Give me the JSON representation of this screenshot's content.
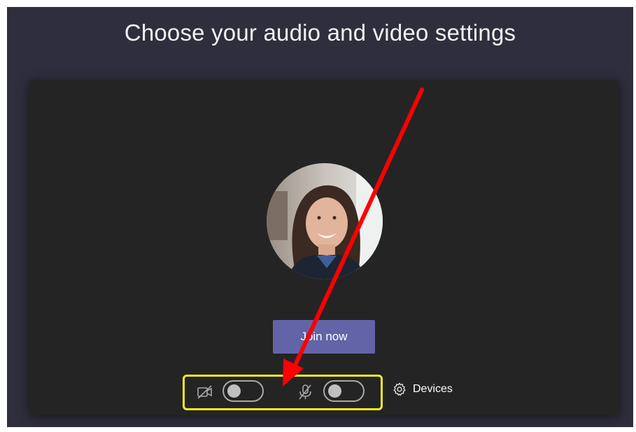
{
  "page": {
    "title": "Choose your audio and video settings"
  },
  "join": {
    "label": "Join now"
  },
  "controls": {
    "camera": {
      "icon": "camera-off-icon",
      "on": false
    },
    "microphone": {
      "icon": "microphone-off-icon",
      "on": false
    },
    "devices_label": "Devices",
    "devices_icon": "gear-icon"
  },
  "colors": {
    "background": "#2f2e3c",
    "panel": "#242424",
    "accent": "#6264a7",
    "highlight": "#f2ef1e",
    "arrow": "#ff0000"
  }
}
